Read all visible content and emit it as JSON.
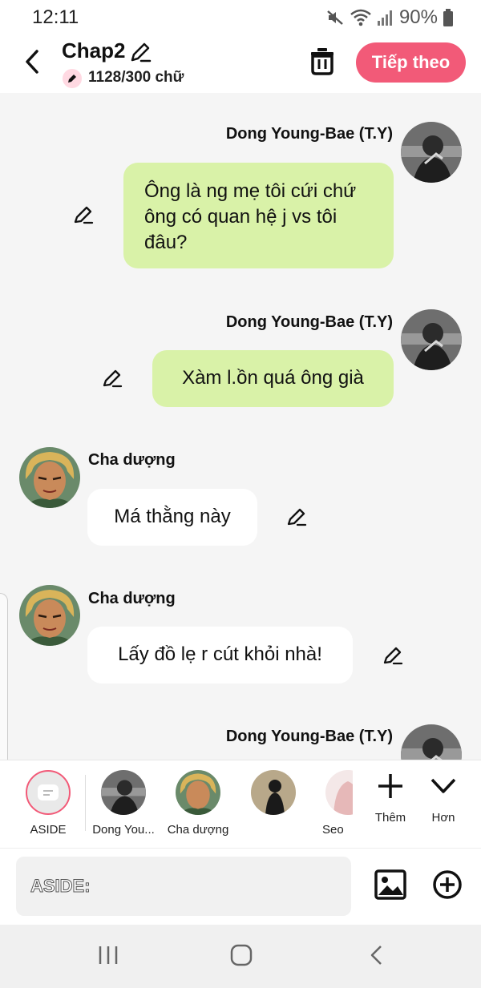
{
  "status_bar": {
    "time": "12:11",
    "battery": "90%"
  },
  "header": {
    "title": "Chap2",
    "word_count": "1128/300 chữ",
    "next_label": "Tiếp theo"
  },
  "messages": [
    {
      "sender": "Dong Young-Bae (T.Y)",
      "text": "Ông là ng mẹ tôi cứi chứ ông có quan hệ j vs tôi đâu?",
      "side": "right"
    },
    {
      "sender": "Dong Young-Bae (T.Y)",
      "text": "Xàm l.ồn quá ông già",
      "side": "right"
    },
    {
      "sender": "Cha dượng",
      "text": "Má thằng này",
      "side": "left"
    },
    {
      "sender": "Cha dượng",
      "text": "Lấy đồ lẹ r cút khỏi nhà!",
      "side": "left"
    },
    {
      "sender": "Dong Young-Bae (T.Y)",
      "text": "",
      "side": "right"
    }
  ],
  "characters": [
    {
      "label": "ASIDE"
    },
    {
      "label": "Dong You..."
    },
    {
      "label": "Cha dượng"
    },
    {
      "label": ""
    },
    {
      "label": "Seo"
    }
  ],
  "actions": {
    "add_label": "Thêm",
    "more_label": "Hơn"
  },
  "input": {
    "placeholder": "ASIDE:"
  },
  "colors": {
    "accent": "#f25a78",
    "my_bubble": "#d9f2a8",
    "their_bubble": "#ffffff",
    "background": "#f5f5f5"
  },
  "icons": [
    "mute-icon",
    "wifi-icon",
    "signal-icon",
    "battery-icon",
    "back-icon",
    "pencil-icon",
    "trash-icon",
    "plus-icon",
    "chevron-down-icon",
    "image-icon",
    "plus-circle-icon",
    "recent-apps-icon",
    "home-icon",
    "nav-back-icon"
  ]
}
